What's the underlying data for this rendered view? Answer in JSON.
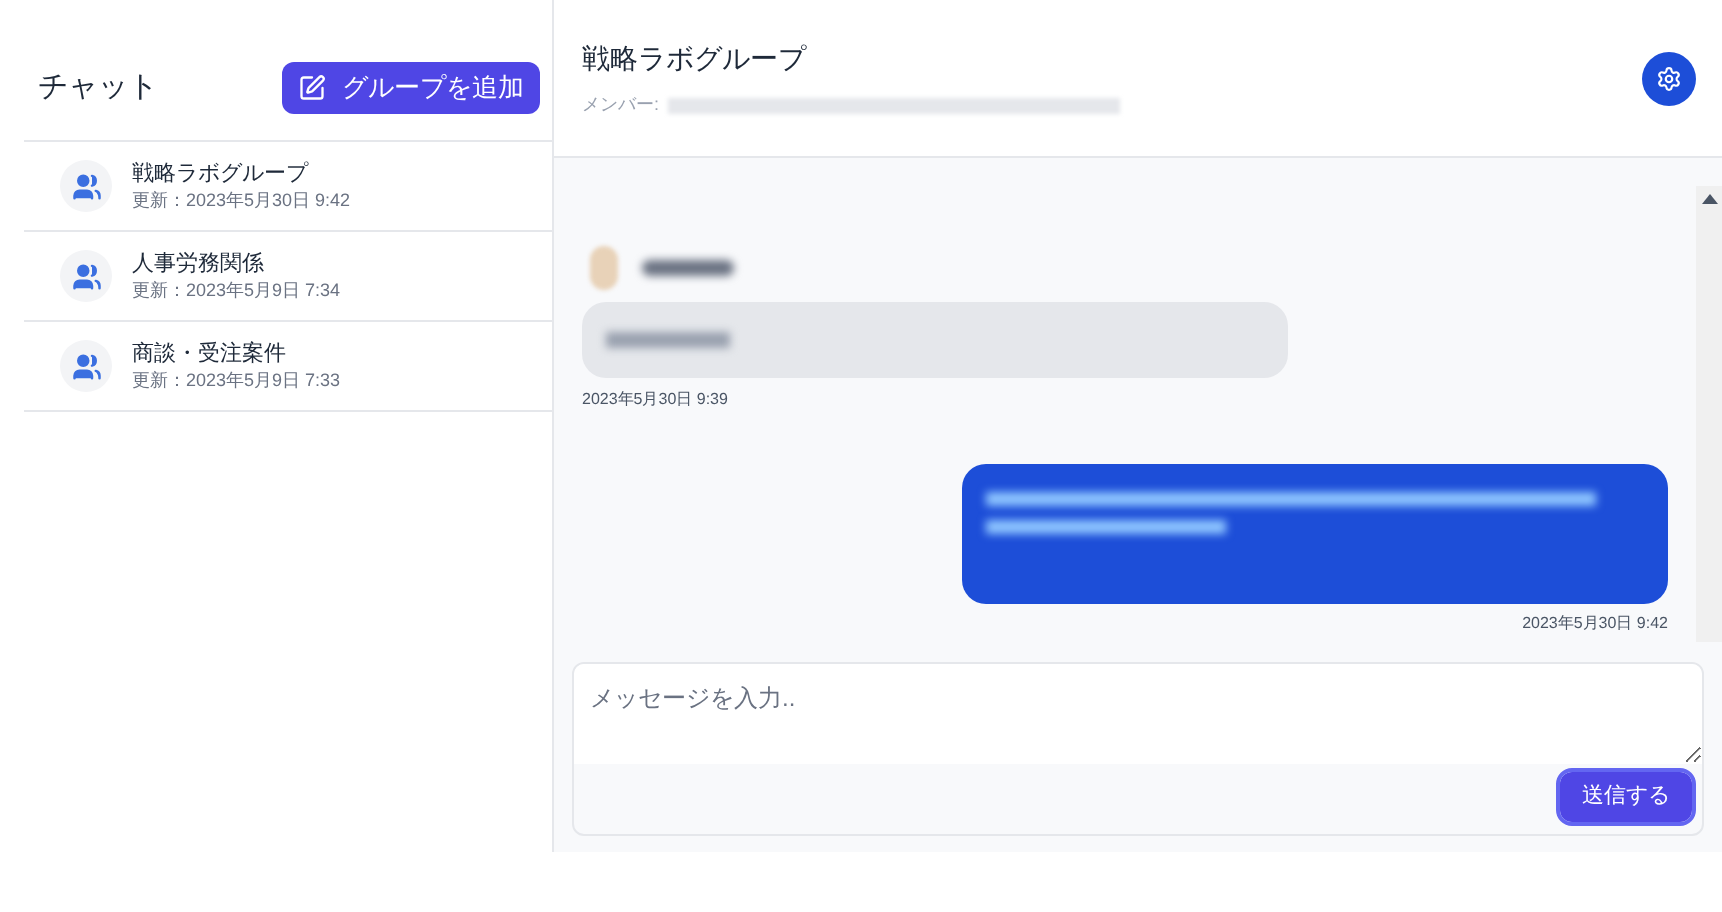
{
  "sidebar": {
    "title": "チャット",
    "add_button": "グループを追加",
    "items": [
      {
        "name": "戦略ラボグループ",
        "updated": "更新：2023年5月30日 9:42"
      },
      {
        "name": "人事労務関係",
        "updated": "更新：2023年5月9日 7:34"
      },
      {
        "name": "商談・受注案件",
        "updated": "更新：2023年5月9日 7:33"
      }
    ]
  },
  "chat": {
    "title": "戦略ラボグループ",
    "members_label": "メンバー:",
    "messages": [
      {
        "kind": "received",
        "time": "2023年5月30日 9:39"
      },
      {
        "kind": "sent",
        "time": "2023年5月30日 9:42"
      }
    ]
  },
  "composer": {
    "placeholder": "メッセージを入力..",
    "send": "送信する"
  }
}
